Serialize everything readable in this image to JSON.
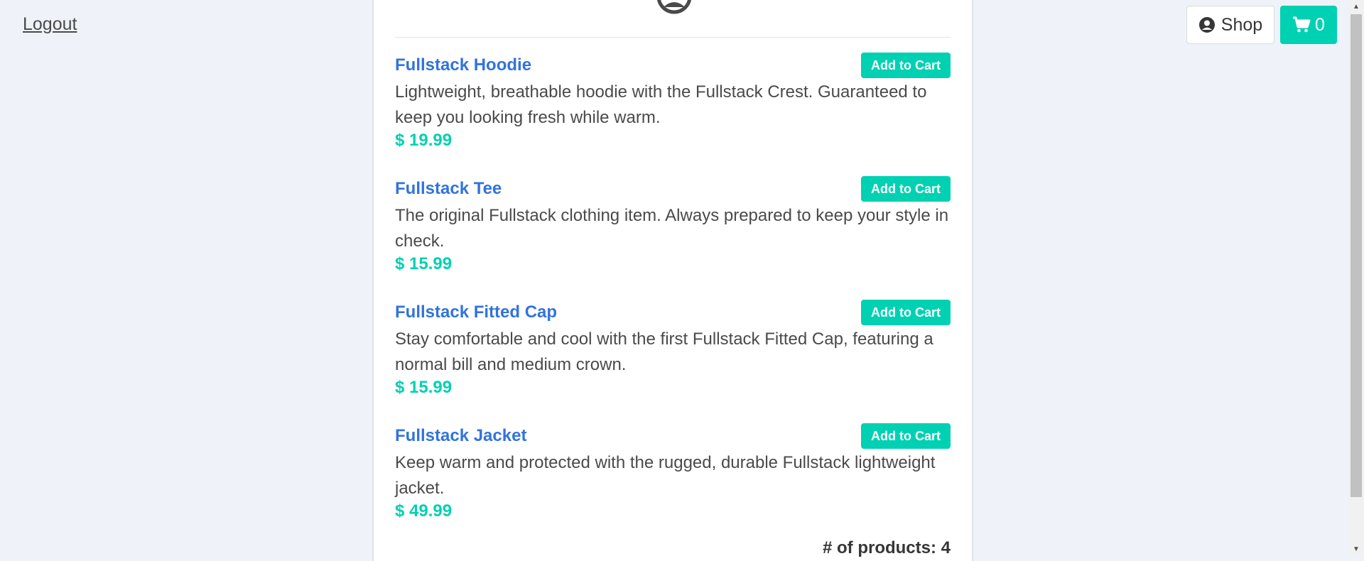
{
  "nav": {
    "logout": "Logout",
    "shop": "Shop",
    "cart_count": "0"
  },
  "products": [
    {
      "name": "Fullstack Hoodie",
      "button": "Add to Cart",
      "description": "Lightweight, breathable hoodie with the Fullstack Crest. Guaranteed to keep you looking fresh while warm.",
      "price": "$ 19.99"
    },
    {
      "name": "Fullstack Tee",
      "button": "Add to Cart",
      "description": "The original Fullstack clothing item. Always prepared to keep your style in check.",
      "price": "$ 15.99"
    },
    {
      "name": "Fullstack Fitted Cap",
      "button": "Add to Cart",
      "description": "Stay comfortable and cool with the first Fullstack Fitted Cap, featuring a normal bill and medium crown.",
      "price": "$ 15.99"
    },
    {
      "name": "Fullstack Jacket",
      "button": "Add to Cart",
      "description": "Keep warm and protected with the rugged, durable Fullstack lightweight jacket.",
      "price": "$ 49.99"
    }
  ],
  "product_count": "# of products: 4",
  "icons": {
    "avatar": "user-circle-icon",
    "shop": "user-circle-icon",
    "cart": "shopping-cart-icon"
  },
  "colors": {
    "accent": "#00d1b2",
    "link": "#3273dc",
    "background": "#eff2f8"
  }
}
